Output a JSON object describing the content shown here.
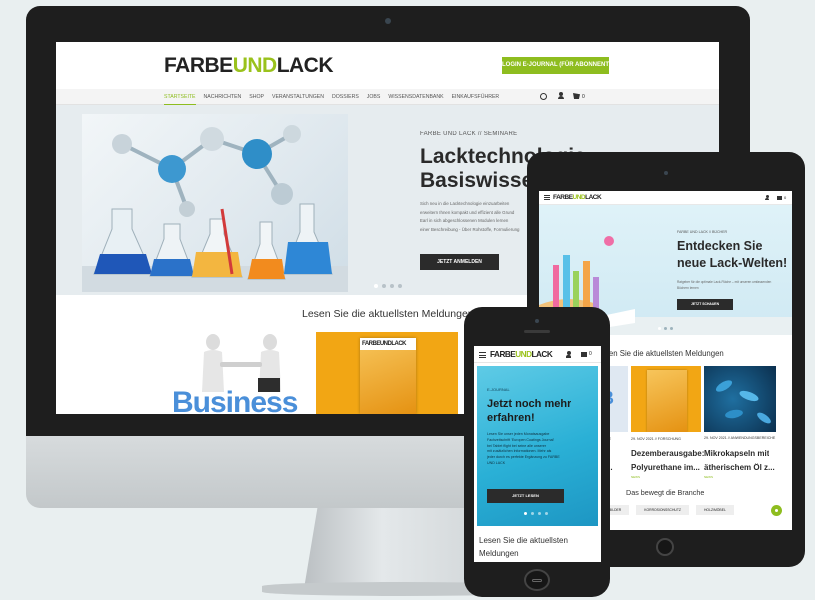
{
  "desktop": {
    "logo": {
      "part1": "FARBE",
      "part2": "UND",
      "part3": "LACK"
    },
    "header_button": "LOGIN E-JOURNAL (FÜR ABONNENTEN)",
    "nav": [
      "STARTSEITE",
      "NACHRICHTEN",
      "SHOP",
      "VERANSTALTUNGEN",
      "DOSSIERS",
      "JOBS",
      "WISSENSDATENBANK",
      "EINKAUFSFÜHRER"
    ],
    "cart_count": "0",
    "hero": {
      "kicker": "FARBE UND LACK // SEMINARE",
      "title_line1": "Lacktechnologie",
      "title_line2": "Basiswissen",
      "body_lines": [
        "Sich neu in die Lacktechnologie einzuarbeiten",
        "erweitern Ihnen kompakt und effizient alle Grund",
        "Earl in sich abgeschlossenen Modulen lernen",
        "einer Beschreibung - Über Rohstoffe, Formulierung"
      ],
      "button": "JETZT ANMELDEN"
    },
    "section_title": "Lesen Sie die aktuellsten Meldungen",
    "business_text": "Business",
    "magazine_logo": "FARBEUNDLACK"
  },
  "tablet": {
    "logo": {
      "part1": "FARBE",
      "part2": "UND",
      "part3": "LACK"
    },
    "cart_count": "0",
    "hero": {
      "kicker": "FARBE UND LACK // BÜCHER",
      "title_line1": "Entdecken Sie",
      "title_line2": "neue Lack-Welten!",
      "body_lines": [
        "Ratgeber für die optimale Lack-Fläche – mit unseren umfassenden",
        "Büchern lernen"
      ],
      "button": "JETZT SCHAUEN"
    },
    "section_title": "sen Sie die aktuellsten Meldungen",
    "cards": [
      {
        "meta": "ANCE",
        "title": "n..."
      },
      {
        "meta": "29. NOV 2021 // FORSCHUNG",
        "title_line1": "Dezemberausgabe:",
        "title_line2": "Polyurethane im...",
        "tag": "NEWS"
      },
      {
        "meta": "29. NOV 2021 // ANWENDUNGSBEREICHE",
        "title_line1": "Mikrokapseln mit",
        "title_line2": "ätherischem Öl z...",
        "tag": "NEWS"
      }
    ],
    "branche_title": "Das bewegt die Branche",
    "pills": [
      "BILDER",
      "KORROSIONSSCHUTZ",
      "HOLZ/MÖBEL"
    ]
  },
  "phone": {
    "logo": {
      "part1": "FARBE",
      "part2": "UND",
      "part3": "LACK"
    },
    "cart_count": "0",
    "hero": {
      "kicker": "E-JOURNAL",
      "title_line1": "Jetzt noch mehr",
      "title_line2": "erfahren!",
      "body_lines": [
        "Lesen Sie unser jeden Monatsausgabe",
        "Fachzeitschrift 'Europen Coatings Journal'",
        "bei Tablet flight bei seine alle unserer",
        "mit zusätzlichen Informationen. Mehr als",
        "jeder durch es perfekte Ergänzung zu FARBE",
        "UND LACK"
      ],
      "button": "JETZT LESEN"
    },
    "section_title_line1": "Lesen Sie die aktuellsten",
    "section_title_line2": "Meldungen"
  },
  "colors": {
    "accent_green": "#8ebd1f",
    "hero_cyan": "#2eb6d8",
    "magazine_orange": "#f2a614",
    "device_dark": "#1f1f1f"
  }
}
